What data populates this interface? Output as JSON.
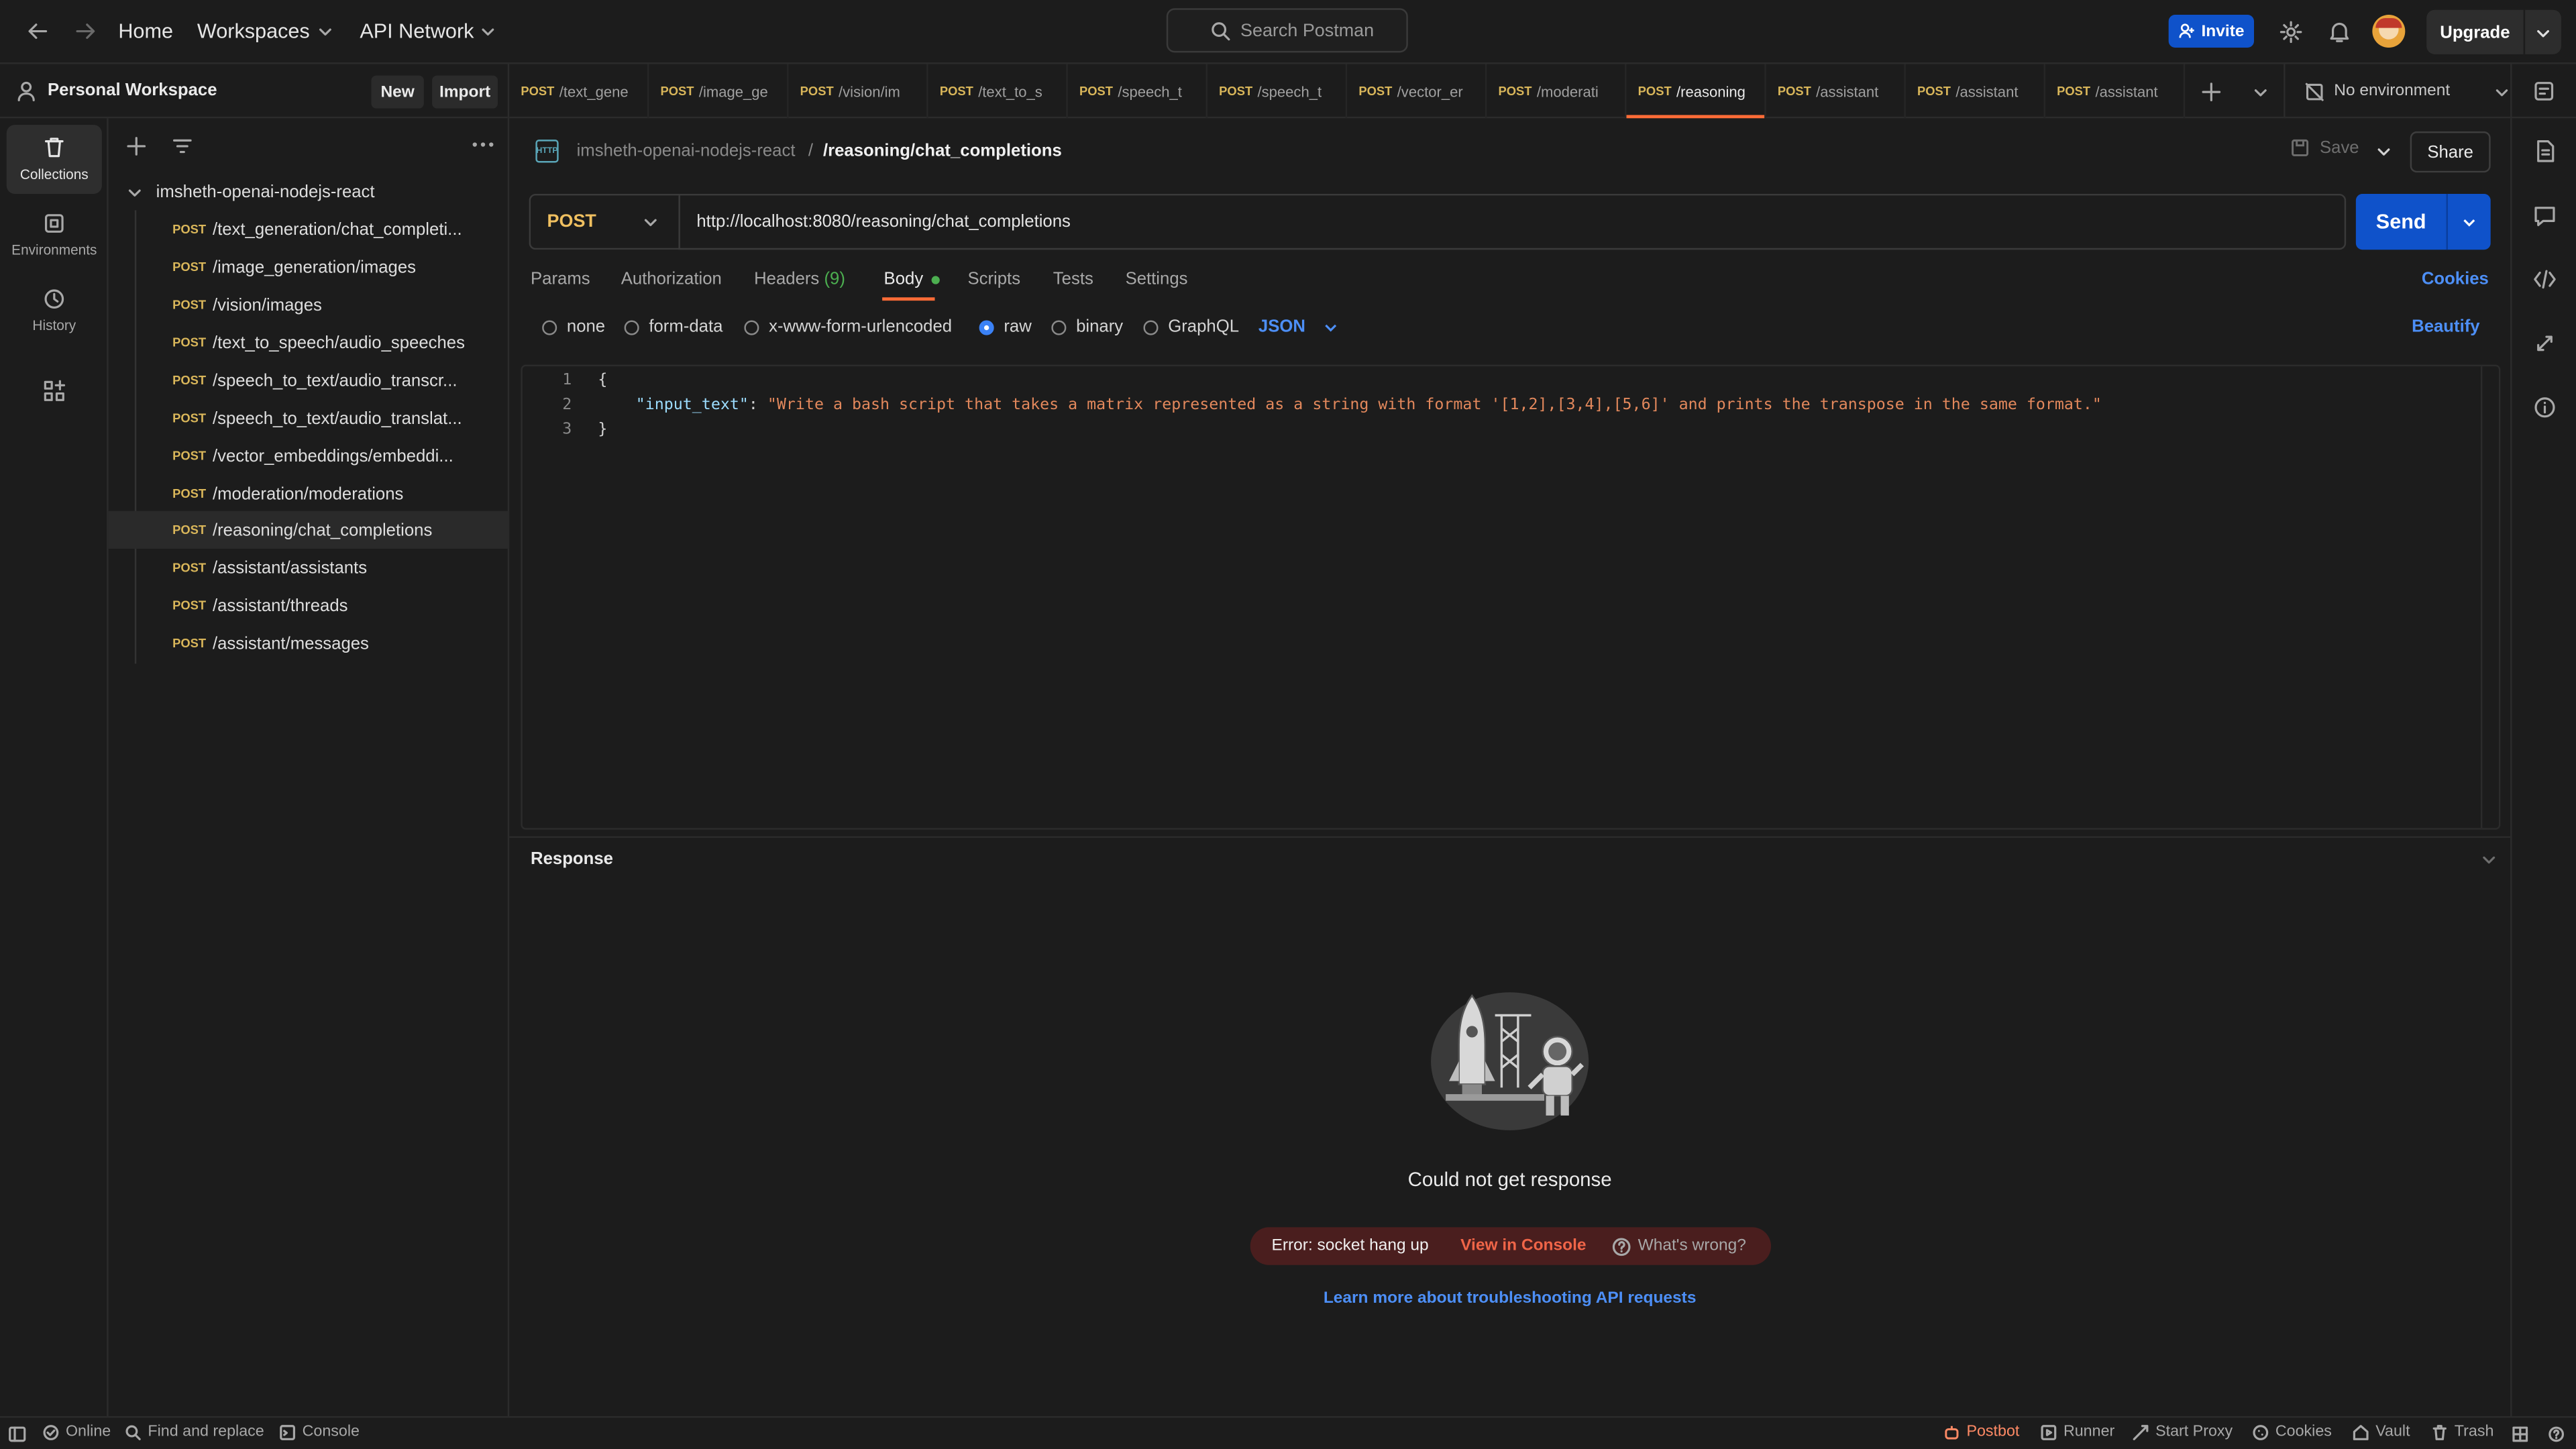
{
  "topbar": {
    "home": "Home",
    "workspaces": "Workspaces",
    "api_network": "API Network",
    "search_placeholder": "Search Postman",
    "invite": "Invite",
    "upgrade": "Upgrade"
  },
  "workspace": {
    "name": "Personal Workspace",
    "new": "New",
    "import": "Import"
  },
  "tabs": [
    {
      "method": "POST",
      "path": "/text_gene"
    },
    {
      "method": "POST",
      "path": "/image_ge"
    },
    {
      "method": "POST",
      "path": "/vision/im"
    },
    {
      "method": "POST",
      "path": "/text_to_s"
    },
    {
      "method": "POST",
      "path": "/speech_t"
    },
    {
      "method": "POST",
      "path": "/speech_t"
    },
    {
      "method": "POST",
      "path": "/vector_er"
    },
    {
      "method": "POST",
      "path": "/moderati"
    },
    {
      "method": "POST",
      "path": "/reasoning"
    },
    {
      "method": "POST",
      "path": "/assistant"
    },
    {
      "method": "POST",
      "path": "/assistant"
    },
    {
      "method": "POST",
      "path": "/assistant"
    }
  ],
  "environment": "No environment",
  "leftnav": {
    "collections": "Collections",
    "environments": "Environments",
    "history": "History"
  },
  "collection": {
    "name": "imsheth-openai-nodejs-react",
    "items": [
      {
        "method": "POST",
        "path": "/text_generation/chat_completi..."
      },
      {
        "method": "POST",
        "path": "/image_generation/images"
      },
      {
        "method": "POST",
        "path": "/vision/images"
      },
      {
        "method": "POST",
        "path": "/text_to_speech/audio_speeches"
      },
      {
        "method": "POST",
        "path": "/speech_to_text/audio_transcr..."
      },
      {
        "method": "POST",
        "path": "/speech_to_text/audio_translat..."
      },
      {
        "method": "POST",
        "path": "/vector_embeddings/embeddi..."
      },
      {
        "method": "POST",
        "path": "/moderation/moderations"
      },
      {
        "method": "POST",
        "path": "/reasoning/chat_completions"
      },
      {
        "method": "POST",
        "path": "/assistant/assistants"
      },
      {
        "method": "POST",
        "path": "/assistant/threads"
      },
      {
        "method": "POST",
        "path": "/assistant/messages"
      }
    ]
  },
  "request": {
    "breadcrumb_parent": "imsheth-openai-nodejs-react",
    "breadcrumb_sep": "/",
    "breadcrumb_current": "/reasoning/chat_completions",
    "save": "Save",
    "share": "Share",
    "method": "POST",
    "url": "http://localhost:8080/reasoning/chat_completions",
    "send": "Send",
    "tabs": {
      "params": "Params",
      "authorization": "Authorization",
      "headers": "Headers",
      "headers_count": "(9)",
      "body": "Body",
      "scripts": "Scripts",
      "tests": "Tests",
      "settings": "Settings"
    },
    "cookies": "Cookies",
    "body_types": {
      "none": "none",
      "form_data": "form-data",
      "urlencoded": "x-www-form-urlencoded",
      "raw": "raw",
      "binary": "binary",
      "graphql": "GraphQL"
    },
    "format": "JSON",
    "beautify": "Beautify",
    "code": {
      "lines": [
        "1",
        "2",
        "3"
      ],
      "open": "{",
      "key": "\"input_text\"",
      "colon": ": ",
      "value": "\"Write a bash script that takes a matrix represented as a string with format '[1,2],[3,4],[5,6]' and prints the transpose in the same format.\"",
      "close": "}"
    }
  },
  "response": {
    "title": "Response",
    "message": "Could not get response",
    "error": "Error: socket hang up",
    "view_console": "View in Console",
    "whats_wrong": "What's wrong?",
    "learn_more": "Learn more about troubleshooting API requests"
  },
  "statusbar": {
    "online": "Online",
    "find_replace": "Find and replace",
    "console": "Console",
    "postbot": "Postbot",
    "runner": "Runner",
    "start_proxy": "Start Proxy",
    "cookies": "Cookies",
    "vault": "Vault",
    "trash": "Trash"
  },
  "colors": {
    "accent_orange": "#ff6c37",
    "send_blue": "#0f52ca",
    "method_post": "#d9b65a",
    "error_red": "#f06548",
    "link_blue": "#4d8ff7"
  }
}
